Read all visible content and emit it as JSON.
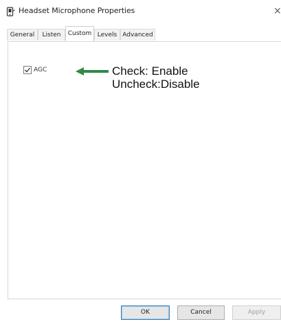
{
  "window": {
    "title": "Headset Microphone Properties",
    "icon": "microphone-icon"
  },
  "tabs": [
    {
      "label": "General",
      "active": false
    },
    {
      "label": "Listen",
      "active": false
    },
    {
      "label": "Custom",
      "active": true
    },
    {
      "label": "Levels",
      "active": false
    },
    {
      "label": "Advanced",
      "active": false
    }
  ],
  "custom": {
    "agc_label": "AGC",
    "agc_checked": true
  },
  "annotation": {
    "line1": "Check: Enable",
    "line2": "Uncheck:Disable",
    "arrow_color": "#2f8a44"
  },
  "buttons": {
    "ok": "OK",
    "cancel": "Cancel",
    "apply": "Apply"
  }
}
